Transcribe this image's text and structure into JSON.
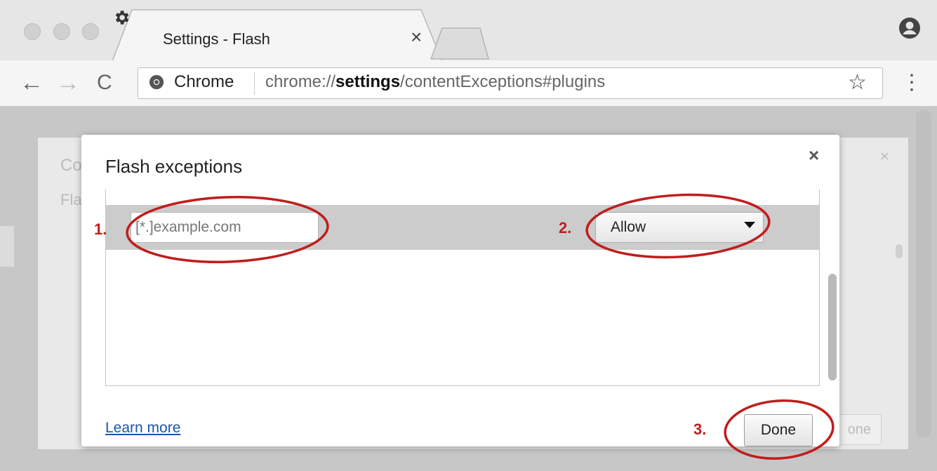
{
  "browser": {
    "tab_title": "Settings - Flash",
    "tab_close": "×",
    "omnibox": {
      "label": "Chrome",
      "url_prefix": "chrome://",
      "url_bold": "settings",
      "url_suffix": "/contentExceptions#plugins"
    },
    "nav": {
      "back": "←",
      "forward": "→",
      "reload": "C"
    },
    "star": "☆",
    "menu": "⋮"
  },
  "background_dialog": {
    "title_fragment": "Co",
    "subtitle_fragment": "Fla",
    "close": "×",
    "done_fragment": "one"
  },
  "dialog": {
    "title": "Flash exceptions",
    "close": "×",
    "row": {
      "pattern_placeholder": "[*.]example.com",
      "behavior": "Allow"
    },
    "learn_more": "Learn more",
    "done_label": "Done"
  },
  "annotations": {
    "step1": "1.",
    "step2": "2.",
    "step3": "3.",
    "color": "#c01d1d"
  }
}
